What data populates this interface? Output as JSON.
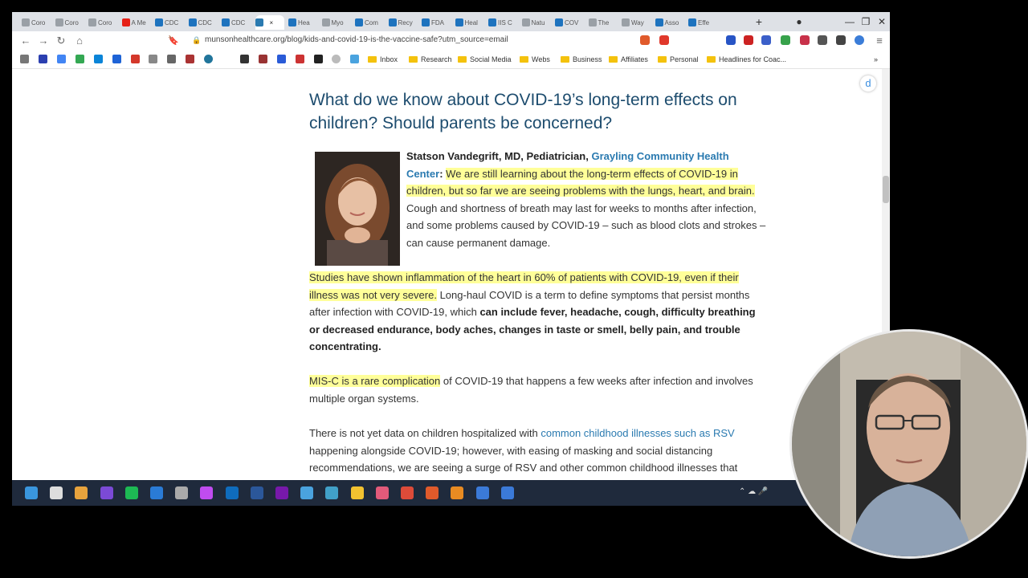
{
  "browser": {
    "tabs": [
      {
        "label": "Coro",
        "color": "#9aa0a6"
      },
      {
        "label": "Coro",
        "color": "#9aa0a6"
      },
      {
        "label": "Coro",
        "color": "#9aa0a6"
      },
      {
        "label": "A Me",
        "color": "#e62117"
      },
      {
        "label": "CDC",
        "color": "#1e73be"
      },
      {
        "label": "CDC",
        "color": "#1e73be"
      },
      {
        "label": "CDC",
        "color": "#1e73be"
      },
      {
        "label": "",
        "color": "#2a7ab0"
      },
      {
        "label": "Hea",
        "color": "#1e73be"
      },
      {
        "label": "Myo",
        "color": "#9aa0a6"
      },
      {
        "label": "Com",
        "color": "#1e73be"
      },
      {
        "label": "Recy",
        "color": "#1e73be"
      },
      {
        "label": "FDA",
        "color": "#1e73be"
      },
      {
        "label": "Heal",
        "color": "#1e73be"
      },
      {
        "label": "IIS C",
        "color": "#1e73be"
      },
      {
        "label": "Natu",
        "color": "#9aa0a6"
      },
      {
        "label": "COV",
        "color": "#1e73be"
      },
      {
        "label": "The",
        "color": "#9aa0a6"
      },
      {
        "label": "Way",
        "color": "#9aa0a6"
      },
      {
        "label": "Asso",
        "color": "#1e73be"
      },
      {
        "label": "Effe",
        "color": "#1e73be"
      }
    ],
    "new_tab": "+",
    "minimize": "—",
    "restore": "❐",
    "close": "✕",
    "url": "munsonhealthcare.org/blog/kids-and-covid-19-is-the-vaccine-safe?utm_source=email",
    "bookmarks": [
      "Inbox",
      "Research",
      "Social Media",
      "Webs",
      "Business",
      "Affiliates",
      "Personal",
      "Headlines for Coac..."
    ],
    "more_bookmarks": "»"
  },
  "article": {
    "title": "What do we know about COVID-19’s long-term effects on children? Should parents be concerned?",
    "p1": {
      "author": "Statson Vandegrift, MD, Pediatrician,",
      "org": "Grayling Community Health Center",
      "colon": ":",
      "highlight": "We are still learning about the long-term effects of COVID-19 in children, but so far we are seeing problems with the lungs, heart, and brain.",
      "rest": "Cough and shortness of breath may last for weeks to months after infection, and some problems caused by COVID-19 – such as blood clots and strokes – can cause permanent damage."
    },
    "p2": {
      "highlight": "Studies have shown inflammation of the heart in 60% of patients with COVID-19, even if their illness was not very severe.",
      "text": "Long-haul COVID is a term to define symptoms that persist months after infection with COVID-19, which",
      "bold": "can include fever, headache, cough, difficulty breathing or decreased endurance, body aches, changes in taste or smell, belly pain, and trouble concentrating."
    },
    "p3": {
      "highlight": "MIS-C is a rare complication",
      "text": "of COVID-19 that happens a few weeks after infection and involves multiple organ systems."
    },
    "p4": {
      "text1": "There is not yet data on children hospitalized with",
      "link": "common childhood illnesses such as RSV",
      "text2": "happening alongside COVID-19; however, with easing of masking and social distancing recommendations, we are seeing a surge of RSV and other common childhood illnesses that"
    }
  },
  "taskbar": {
    "icons": [
      "start",
      "search",
      "files",
      "app",
      "spotify",
      "amazon-music",
      "media",
      "itunes",
      "outlook",
      "word",
      "onenote",
      "notepad",
      "maps",
      "folder",
      "tool",
      "chrome",
      "brave",
      "app2",
      "vscode",
      "vscode2"
    ],
    "tray": "⌃ ☁ 🎤"
  }
}
